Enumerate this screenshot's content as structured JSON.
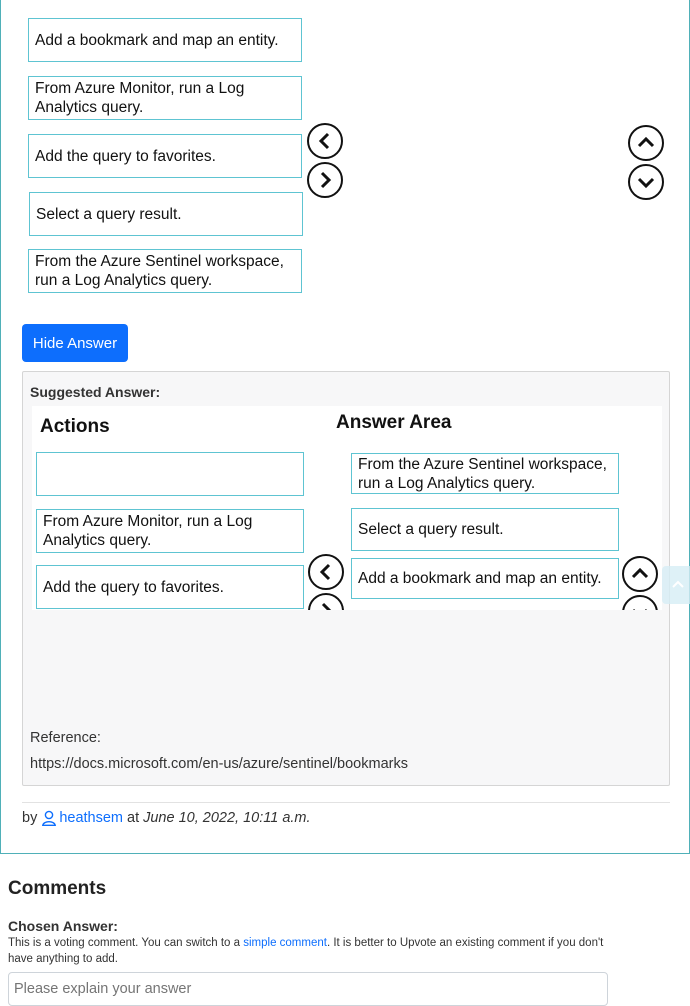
{
  "question": {
    "choices": [
      "Add a bookmark and map an entity.",
      "From Azure Monitor, run a Log Analytics query.",
      "Add the query to favorites.",
      "Select a query result.",
      "From the Azure Sentinel workspace, run a Log Analytics query."
    ]
  },
  "hide_answer_label": "Hide Answer",
  "suggested": {
    "label": "Suggested Answer:",
    "actions_header": "Actions",
    "answer_area_header": "Answer Area",
    "actions": [
      "",
      "From Azure Monitor, run a Log Analytics query.",
      "Add the query to favorites."
    ],
    "answer_area": [
      "From the Azure Sentinel workspace, run a Log Analytics query.",
      "Select a query result.",
      "Add a bookmark and map an entity."
    ],
    "reference_label": "Reference:",
    "reference_url": "https://docs.microsoft.com/en-us/azure/sentinel/bookmarks"
  },
  "attribution": {
    "by": "by",
    "user": "heathsem",
    "at": "at",
    "date": "June 10, 2022, 10:11 a.m."
  },
  "comments": {
    "title": "Comments",
    "chosen_answer_label": "Chosen Answer:",
    "note_before": "This is a voting comment. You can switch to a ",
    "note_link": "simple comment",
    "note_after": ". It is better to Upvote an existing comment if you don't have anything to add.",
    "input_placeholder": "Please explain your answer"
  },
  "colors": {
    "accent": "#0d6efd",
    "box_border": "#5ec4d2",
    "card_border": "#4fb0b8"
  }
}
